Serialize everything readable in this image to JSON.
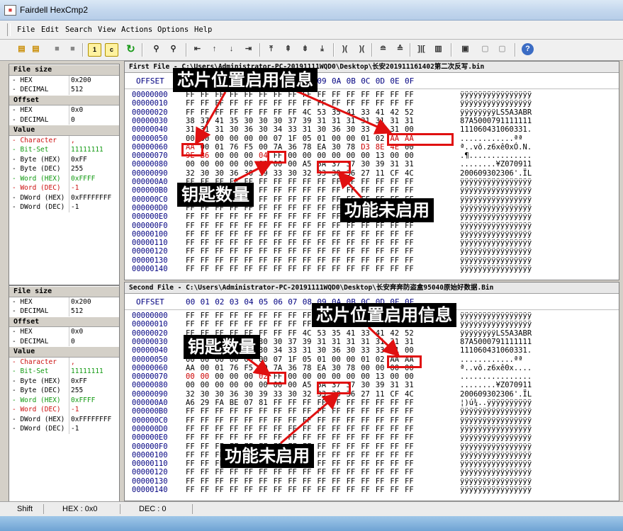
{
  "window": {
    "title": "Fairdell HexCmp2",
    "icon_label": "hex-compare-app-icon"
  },
  "menu": [
    "File",
    "Edit",
    "Search",
    "View",
    "Actions",
    "Options",
    "Help"
  ],
  "toolbar_icons": [
    "open-first-icon",
    "open-second-icon",
    "stop-icon",
    "stop2-icon",
    "one-icon",
    "c-icon",
    "refresh-icon",
    "find-icon",
    "find-next-icon",
    "first-diff-icon",
    "prev-diff-icon",
    "next-diff-icon",
    "last-diff-icon",
    "goto-top-icon",
    "page-up-icon",
    "page-down-icon",
    "goto-end-icon",
    "sync-left-icon",
    "sync-right-icon",
    "sync-on-icon",
    "sync-off-icon",
    "columns-icon",
    "list-icon",
    "print-icon",
    "copy-icon",
    "paste-icon",
    "help-icon"
  ],
  "sidebar": [
    {
      "kind": "head",
      "label": "File size"
    },
    {
      "kind": "row",
      "label": "- HEX",
      "value": "0x200"
    },
    {
      "kind": "row",
      "label": "- DECIMAL",
      "value": "512"
    },
    {
      "kind": "head",
      "label": "Offset"
    },
    {
      "kind": "row",
      "label": "- HEX",
      "value": "0x0"
    },
    {
      "kind": "row",
      "label": "- DECIMAL",
      "value": "0"
    },
    {
      "kind": "head",
      "label": "Value"
    },
    {
      "kind": "row",
      "label": "- Character",
      "value": ",",
      "tone": "red"
    },
    {
      "kind": "row",
      "label": "- Bit-Set",
      "value": "11111111",
      "tone": "green"
    },
    {
      "kind": "row",
      "label": "- Byte (HEX)",
      "value": "0xFF"
    },
    {
      "kind": "row",
      "label": "- Byte (DEC)",
      "value": "255"
    },
    {
      "kind": "row",
      "label": "- Word (HEX)",
      "value": "0xFFFF",
      "tone": "green"
    },
    {
      "kind": "row",
      "label": "- Word (DEC)",
      "value": "-1",
      "tone": "red"
    },
    {
      "kind": "row",
      "label": "- DWord (HEX)",
      "value": "0xFFFFFFFF"
    },
    {
      "kind": "row",
      "label": "- DWord (DEC)",
      "value": "-1"
    }
  ],
  "header": {
    "offset_label": "OFFSET",
    "columns": [
      "00",
      "01",
      "02",
      "03",
      "04",
      "05",
      "06",
      "07",
      "08",
      "09",
      "0A",
      "0B",
      "0C",
      "0D",
      "0E",
      "0F"
    ]
  },
  "panels": [
    {
      "title": "First File - C:\\Users\\Administrator-PC-20191111WQD0\\Desktop\\长安201911161402第二次反写.bin",
      "rows": [
        {
          "off": "00000000",
          "hex": "FF FF FF FF FF FF FF FF FF FF FF FF FF FF FF FF",
          "asc": "ÿÿÿÿÿÿÿÿÿÿÿÿÿÿÿÿ",
          "diff": []
        },
        {
          "off": "00000010",
          "hex": "FF FF FF FF FF FF FF FF FF FF FF FF FF FF FF FF",
          "asc": "ÿÿÿÿÿÿÿÿÿÿÿÿÿÿÿÿ",
          "diff": []
        },
        {
          "off": "00000020",
          "hex": "FF FF FF FF FF FF FF FF 4C 53 35 41 33 41 42 52",
          "asc": "ÿÿÿÿÿÿÿÿLS5A3ABR",
          "diff": []
        },
        {
          "off": "00000030",
          "hex": "38 37 41 35 30 30 30 37 39 31 31 31 31 31 31 31",
          "asc": "87A5000791111111",
          "diff": []
        },
        {
          "off": "00000040",
          "hex": "31 31 31 30 36 30 34 33 31 30 36 30 33 33 31 00",
          "asc": "111060431060331.",
          "diff": []
        },
        {
          "off": "00000050",
          "hex": "00 00 00 00 00 00 07 1F 05 01 00 00 01 02 AA AA",
          "asc": "............ªª",
          "diff": [
            14,
            15
          ]
        },
        {
          "off": "00000060",
          "hex": "AA 00 01 76 F5 00 7A 36 78 EA 30 78 D3 8E 4E 00",
          "asc": "ª..võ.z6xê0xÓ.N.",
          "diff": [
            0,
            12,
            13,
            14
          ]
        },
        {
          "off": "00000070",
          "hex": "9E B6 00 00 00 04 FF 00 00 00 00 00 00 13 00 00",
          "asc": ".¶..............",
          "diff": [
            0,
            1,
            5
          ]
        },
        {
          "off": "00000080",
          "hex": "00 00 00 00 00 00 00 00 A5 5A 37 37 30 39 31 31",
          "asc": "........¥Z070911",
          "diff": []
        },
        {
          "off": "00000090",
          "hex": "32 30 30 36 30 39 33 30 32 33 30 36 27 11 CF 4C",
          "asc": "200609302306'.ÏL",
          "diff": []
        },
        {
          "off": "000000A0",
          "hex": "FF FF FF FF FF FF FF FF FF FF FF FF FF FF FF FF",
          "asc": "ÿÿÿÿÿÿÿÿÿÿÿÿÿÿÿÿ",
          "diff": []
        },
        {
          "off": "000000B0",
          "hex": "FF FF FF FF FF FF FF FF FF FF FF FF FF FF FF FF",
          "asc": "ÿÿÿÿÿÿÿÿÿÿÿÿÿÿÿÿ",
          "diff": []
        },
        {
          "off": "000000C0",
          "hex": "FF FF FF FF FF FF FF FF FF FF FF FF FF FF FF FF",
          "asc": "ÿÿÿÿÿÿÿÿÿÿÿÿÿÿÿÿ",
          "diff": []
        },
        {
          "off": "000000D0",
          "hex": "FF FF FF FF FF FF FF FF FF FF FF FF FF FF FF FF",
          "asc": "ÿÿÿÿÿÿÿÿÿÿÿÿÿÿÿÿ",
          "diff": []
        },
        {
          "off": "000000E0",
          "hex": "FF FF FF FF FF FF FF FF FF FF FF FF FF FF FF FF",
          "asc": "ÿÿÿÿÿÿÿÿÿÿÿÿÿÿÿÿ",
          "diff": []
        },
        {
          "off": "000000F0",
          "hex": "FF FF FF FF FF FF FF FF FF FF FF FF FF FF FF FF",
          "asc": "ÿÿÿÿÿÿÿÿÿÿÿÿÿÿÿÿ",
          "diff": []
        },
        {
          "off": "00000100",
          "hex": "FF FF FF FF FF FF FF FF FF FF FF FF FF FF FF FF",
          "asc": "ÿÿÿÿÿÿÿÿÿÿÿÿÿÿÿÿ",
          "diff": []
        },
        {
          "off": "00000110",
          "hex": "FF FF FF FF FF FF FF FF FF FF FF FF FF FF FF FF",
          "asc": "ÿÿÿÿÿÿÿÿÿÿÿÿÿÿÿÿ",
          "diff": []
        },
        {
          "off": "00000120",
          "hex": "FF FF FF FF FF FF FF FF FF FF FF FF FF FF FF FF",
          "asc": "ÿÿÿÿÿÿÿÿÿÿÿÿÿÿÿÿ",
          "diff": []
        },
        {
          "off": "00000130",
          "hex": "FF FF FF FF FF FF FF FF FF FF FF FF FF FF FF FF",
          "asc": "ÿÿÿÿÿÿÿÿÿÿÿÿÿÿÿÿ",
          "diff": []
        },
        {
          "off": "00000140",
          "hex": "FF FF FF FF FF FF FF FF FF FF FF FF FF FF FF FF",
          "asc": "ÿÿÿÿÿÿÿÿÿÿÿÿÿÿÿÿ",
          "diff": []
        }
      ]
    },
    {
      "title": "Second File - C:\\Users\\Administrator-PC-20191111WQD0\\Desktop\\长安奔奔防盗盒95040原始好数据.Bin",
      "rows": [
        {
          "off": "00000000",
          "hex": "FF FF FF FF FF FF FF FF FF FF FF FF FF FF FF FF",
          "asc": "ÿÿÿÿÿÿÿÿÿÿÿÿÿÿÿÿ",
          "diff": []
        },
        {
          "off": "00000010",
          "hex": "FF FF FF FF FF FF FF FF FF FF FF FF FF FF FF FF",
          "asc": "ÿÿÿÿÿÿÿÿÿÿÿÿÿÿÿÿ",
          "diff": []
        },
        {
          "off": "00000020",
          "hex": "FF FF FF FF FF FF FF FF 4C 53 35 41 33 41 42 52",
          "asc": "ÿÿÿÿÿÿÿÿLS5A3ABR",
          "diff": []
        },
        {
          "off": "00000030",
          "hex": "38 37 41 35 30 30 30 37 39 31 31 31 31 31 31 31",
          "asc": "87A5000791111111",
          "diff": []
        },
        {
          "off": "00000040",
          "hex": "31 31 31 30 36 30 34 33 31 30 36 30 33 33 31 00",
          "asc": "111060431060331.",
          "diff": []
        },
        {
          "off": "00000050",
          "hex": "00 00 00 00 00 00 07 1F 05 01 00 00 01 02 AA AA",
          "asc": "............ªª",
          "diff": []
        },
        {
          "off": "00000060",
          "hex": "AA 00 01 76 F5 00 7A 36 78 EA 30 78 00 00 00 00",
          "asc": "ª..võ.z6xê0x....",
          "diff": []
        },
        {
          "off": "00000070",
          "hex": "00 00 00 00 00 02 FF 00 00 00 00 00 00 13 00 00",
          "asc": "................",
          "diff": [
            0,
            1,
            5
          ]
        },
        {
          "off": "00000080",
          "hex": "00 00 00 00 00 00 00 00 A5 5A 37 37 30 39 31 31",
          "asc": "........¥Z070911",
          "diff": []
        },
        {
          "off": "00000090",
          "hex": "32 30 30 36 30 39 33 30 32 33 30 36 27 11 CF 4C",
          "asc": "200609302306'.ÏL",
          "diff": []
        },
        {
          "off": "000000A0",
          "hex": "A6 29 FA BE 07 81 FF FF FF FF FF FF FF FF FF FF",
          "asc": "¦)ú¾..ÿÿÿÿÿÿÿÿÿÿ",
          "diff": []
        },
        {
          "off": "000000B0",
          "hex": "FF FF FF FF FF FF FF FF FF FF FF FF FF FF FF FF",
          "asc": "ÿÿÿÿÿÿÿÿÿÿÿÿÿÿÿÿ",
          "diff": []
        },
        {
          "off": "000000C0",
          "hex": "FF FF FF FF FF FF FF FF FF FF FF FF FF FF FF FF",
          "asc": "ÿÿÿÿÿÿÿÿÿÿÿÿÿÿÿÿ",
          "diff": []
        },
        {
          "off": "000000D0",
          "hex": "FF FF FF FF FF FF FF FF FF FF FF FF FF FF FF FF",
          "asc": "ÿÿÿÿÿÿÿÿÿÿÿÿÿÿÿÿ",
          "diff": []
        },
        {
          "off": "000000E0",
          "hex": "FF FF FF FF FF FF FF FF FF FF FF FF FF FF FF FF",
          "asc": "ÿÿÿÿÿÿÿÿÿÿÿÿÿÿÿÿ",
          "diff": []
        },
        {
          "off": "000000F0",
          "hex": "FF FF FF FF FF FF FF FF FF FF FF FF FF FF FF FF",
          "asc": "ÿÿÿÿÿÿÿÿÿÿÿÿÿÿÿÿ",
          "diff": []
        },
        {
          "off": "00000100",
          "hex": "FF FF FF FF FF FF FF FF FF FF FF FF FF FF FF FF",
          "asc": "ÿÿÿÿÿÿÿÿÿÿÿÿÿÿÿÿ",
          "diff": []
        },
        {
          "off": "00000110",
          "hex": "FF FF FF FF FF FF FF FF FF FF FF FF FF FF FF FF",
          "asc": "ÿÿÿÿÿÿÿÿÿÿÿÿÿÿÿÿ",
          "diff": []
        },
        {
          "off": "00000120",
          "hex": "FF FF FF FF FF FF FF FF FF FF FF FF FF FF FF FF",
          "asc": "ÿÿÿÿÿÿÿÿÿÿÿÿÿÿÿÿ",
          "diff": []
        },
        {
          "off": "00000130",
          "hex": "FF FF FF FF FF FF FF FF FF FF FF FF FF FF FF FF",
          "asc": "ÿÿÿÿÿÿÿÿÿÿÿÿÿÿÿÿ",
          "diff": []
        },
        {
          "off": "00000140",
          "hex": "FF FF FF FF FF FF FF FF FF FF FF FF FF FF FF FF",
          "asc": "ÿÿÿÿÿÿÿÿÿÿÿÿÿÿÿÿ",
          "diff": []
        }
      ]
    }
  ],
  "annotations": {
    "chip_label": "芯片位置启用信息",
    "key_count_label": "钥匙数量",
    "feature_off_label": "功能未启用",
    "highlight_color": "#e01010"
  },
  "status": {
    "shift_label": "Shift",
    "hex_label": "HEX : 0x0",
    "dec_label": "DEC : 0"
  },
  "colors": {
    "diff_text": "#cc0000",
    "offset_text": "#000080",
    "bit_green": "#119911"
  }
}
